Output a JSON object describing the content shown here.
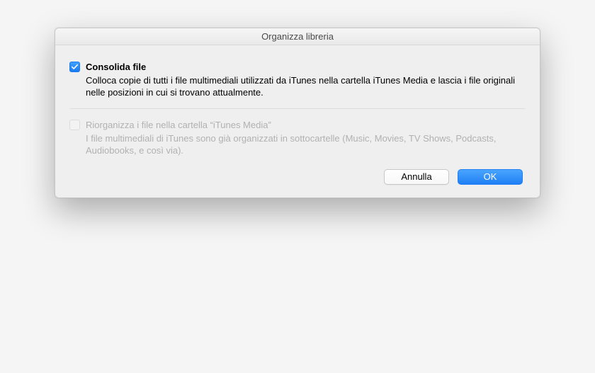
{
  "dialog": {
    "title": "Organizza libreria",
    "options": {
      "consolidate": {
        "label": "Consolida file",
        "description": "Colloca copie di tutti i file multimediali utilizzati da iTunes nella cartella iTunes Media e lascia i file originali nelle posizioni in cui si trovano attualmente.",
        "checked": true,
        "enabled": true
      },
      "reorganize": {
        "label": "Riorganizza i file nella cartella “iTunes Media”",
        "description": "I file multimediali di iTunes sono già organizzati in sottocartelle (Music, Movies, TV Shows, Podcasts, Audiobooks, e così via).",
        "checked": false,
        "enabled": false
      }
    },
    "buttons": {
      "cancel": "Annulla",
      "ok": "OK"
    }
  }
}
